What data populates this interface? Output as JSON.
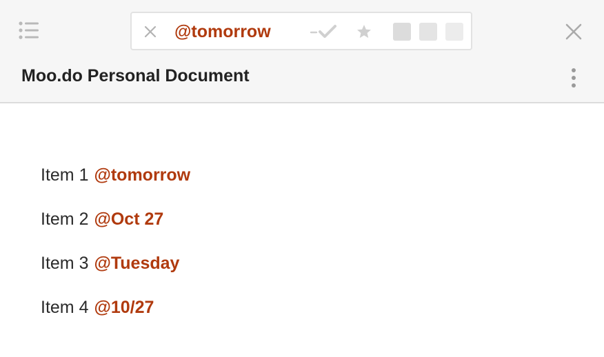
{
  "toolbar": {
    "menu_icon": "list-icon",
    "filter": {
      "clear_icon": "close-icon",
      "text": "@tomorrow",
      "done_icon": "dash-check-icon",
      "star_icon": "star-icon",
      "swatches": [
        "#dcdcdc",
        "#e4e4e4",
        "#ececec"
      ]
    },
    "close_icon": "close-icon"
  },
  "document": {
    "title": "Moo.do Personal Document",
    "more_icon": "more-vertical-icon",
    "items": [
      {
        "label": "Item 1",
        "tag": "@tomorrow"
      },
      {
        "label": "Item 2",
        "tag": "@Oct 27"
      },
      {
        "label": "Item 3",
        "tag": "@Tuesday"
      },
      {
        "label": "Item 4",
        "tag": "@10/27"
      }
    ]
  },
  "colors": {
    "accent": "#b03a0e",
    "header_bg": "#f6f6f6",
    "divider": "#dcdcdc"
  }
}
